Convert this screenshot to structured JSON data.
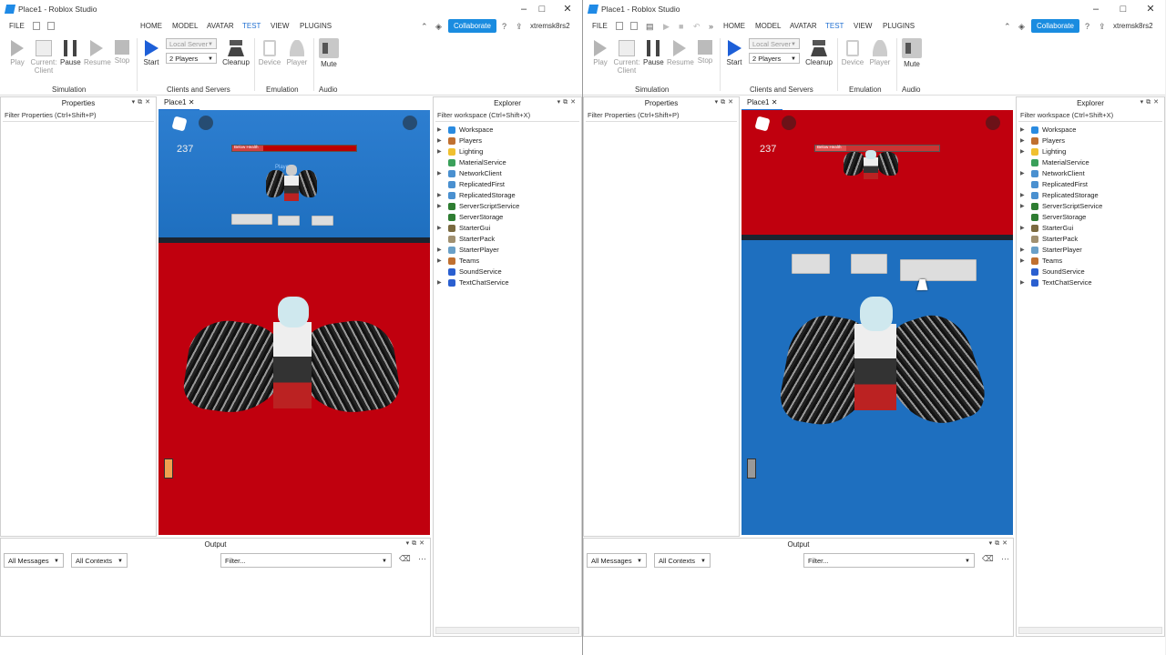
{
  "windows": [
    {
      "title": "Place1 - Roblox Studio",
      "menu": [
        "FILE",
        "HOME",
        "MODEL",
        "AVATAR",
        "TEST",
        "VIEW",
        "PLUGINS"
      ],
      "active_menu": "TEST",
      "collaborate": "Collaborate",
      "username": "xtremsk8rs2",
      "tools": {
        "play": "Play",
        "current_client": "Current:",
        "current_client2": "Client",
        "pause": "Pause",
        "resume": "Resume",
        "stop": "Stop",
        "start": "Start",
        "cleanup": "Cleanup",
        "device": "Device",
        "player": "Player",
        "mute": "Mute"
      },
      "server_dropdown": "Local Server",
      "players_dropdown": "2 Players",
      "groups": {
        "simulation": "Simulation",
        "clients": "Clients and Servers",
        "emulation": "Emulation",
        "audio": "Audio"
      },
      "properties_title": "Properties",
      "properties_filter": "Filter Properties (Ctrl+Shift+P)",
      "tab": "Place1",
      "hud_number": "237",
      "hp_text": "Below Health",
      "player_tag": "Player",
      "explorer_title": "Explorer",
      "explorer_filter": "Filter workspace (Ctrl+Shift+X)",
      "explorer_items": [
        "Workspace",
        "Players",
        "Lighting",
        "MaterialService",
        "NetworkClient",
        "ReplicatedFirst",
        "ReplicatedStorage",
        "ServerScriptService",
        "ServerStorage",
        "StarterGui",
        "StarterPack",
        "StarterPlayer",
        "Teams",
        "SoundService",
        "TextChatService"
      ],
      "output_title": "Output",
      "output_messages": "All Messages",
      "output_contexts": "All Contexts",
      "output_filter": "Filter..."
    },
    {
      "title": "Place1 - Roblox Studio",
      "menu": [
        "FILE",
        "HOME",
        "MODEL",
        "AVATAR",
        "TEST",
        "VIEW",
        "PLUGINS"
      ],
      "active_menu": "TEST",
      "collaborate": "Collaborate",
      "username": "xtremsk8rs2",
      "tools": {
        "play": "Play",
        "current_client": "Current:",
        "current_client2": "Client",
        "pause": "Pause",
        "resume": "Resume",
        "stop": "Stop",
        "start": "Start",
        "cleanup": "Cleanup",
        "device": "Device",
        "player": "Player",
        "mute": "Mute"
      },
      "server_dropdown": "Local Server",
      "players_dropdown": "2 Players",
      "groups": {
        "simulation": "Simulation",
        "clients": "Clients and Servers",
        "emulation": "Emulation",
        "audio": "Audio"
      },
      "properties_title": "Properties",
      "properties_filter": "Filter Properties (Ctrl+Shift+P)",
      "tab": "Place1",
      "hud_number": "237",
      "hp_text": "Below Health",
      "explorer_title": "Explorer",
      "explorer_filter": "Filter workspace (Ctrl+Shift+X)",
      "explorer_items": [
        "Workspace",
        "Players",
        "Lighting",
        "MaterialService",
        "NetworkClient",
        "ReplicatedFirst",
        "ReplicatedStorage",
        "ServerScriptService",
        "ServerStorage",
        "StarterGui",
        "StarterPack",
        "StarterPlayer",
        "Teams",
        "SoundService",
        "TextChatService"
      ],
      "output_title": "Output",
      "output_messages": "All Messages",
      "output_contexts": "All Contexts",
      "output_filter": "Filter..."
    }
  ],
  "colors": {
    "accent": "#1f6fd1",
    "collaborate": "#1a8ce0",
    "game_red": "#c0000e",
    "game_blue": "#1e6fbf"
  }
}
